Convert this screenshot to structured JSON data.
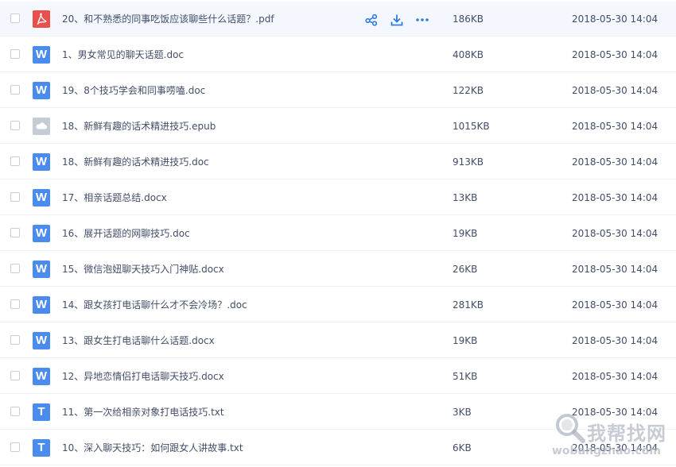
{
  "files": [
    {
      "name": "20、和不熟悉的同事吃饭应该聊些什么话题？.pdf",
      "type": "pdf",
      "icon": "pdf-icon",
      "size": "186KB",
      "date": "2018-05-30 14:04",
      "hover": true
    },
    {
      "name": "1、男女常见的聊天话题.doc",
      "type": "doc",
      "icon": "word-doc-icon",
      "size": "408KB",
      "date": "2018-05-30 14:04"
    },
    {
      "name": "19、8个技巧学会和同事唠嗑.doc",
      "type": "doc",
      "icon": "word-doc-icon",
      "size": "122KB",
      "date": "2018-05-30 14:04"
    },
    {
      "name": "18、新鲜有趣的话术精进技巧.epub",
      "type": "epub",
      "icon": "cloud-file-icon",
      "size": "1015KB",
      "date": "2018-05-30 14:04"
    },
    {
      "name": "18、新鲜有趣的话术精进技巧.doc",
      "type": "doc",
      "icon": "word-doc-icon",
      "size": "913KB",
      "date": "2018-05-30 14:04"
    },
    {
      "name": "17、相亲话题总结.docx",
      "type": "doc",
      "icon": "word-doc-icon",
      "size": "13KB",
      "date": "2018-05-30 14:04"
    },
    {
      "name": "16、展开话题的网聊技巧.doc",
      "type": "doc",
      "icon": "word-doc-icon",
      "size": "19KB",
      "date": "2018-05-30 14:04"
    },
    {
      "name": "15、微信泡妞聊天技巧入门神贴.docx",
      "type": "doc",
      "icon": "word-doc-icon",
      "size": "26KB",
      "date": "2018-05-30 14:04"
    },
    {
      "name": "14、跟女孩打电话聊什么才不会冷场？.doc",
      "type": "doc",
      "icon": "word-doc-icon",
      "size": "281KB",
      "date": "2018-05-30 14:04"
    },
    {
      "name": "13、跟女生打电话聊什么话题.docx",
      "type": "doc",
      "icon": "word-doc-icon",
      "size": "19KB",
      "date": "2018-05-30 14:04"
    },
    {
      "name": "12、异地恋情侣打电话聊天技巧.docx",
      "type": "doc",
      "icon": "word-doc-icon",
      "size": "51KB",
      "date": "2018-05-30 14:04"
    },
    {
      "name": "11、第一次给相亲对象打电话技巧.txt",
      "type": "txt",
      "icon": "text-file-icon",
      "size": "3KB",
      "date": "2018-05-30 14:04"
    },
    {
      "name": "10、深入聊天技巧：如何跟女人讲故事.txt",
      "type": "txt",
      "icon": "text-file-icon",
      "size": "6KB",
      "date": "2018-05-30 14:04"
    }
  ],
  "icon_letters": {
    "doc": "W",
    "txt": "T"
  },
  "hover_actions": [
    {
      "name": "share-icon"
    },
    {
      "name": "download-icon"
    },
    {
      "name": "more-icon"
    }
  ],
  "colors": {
    "accent": "#2f7de1",
    "doc": "#4a8bee",
    "pdf": "#e9504d",
    "epub": "#c5ccd6",
    "text": "#424e67",
    "hover_row": "#f4f8fe"
  },
  "watermark": {
    "title": "我帮找网",
    "url": "wobangzhao.com"
  }
}
